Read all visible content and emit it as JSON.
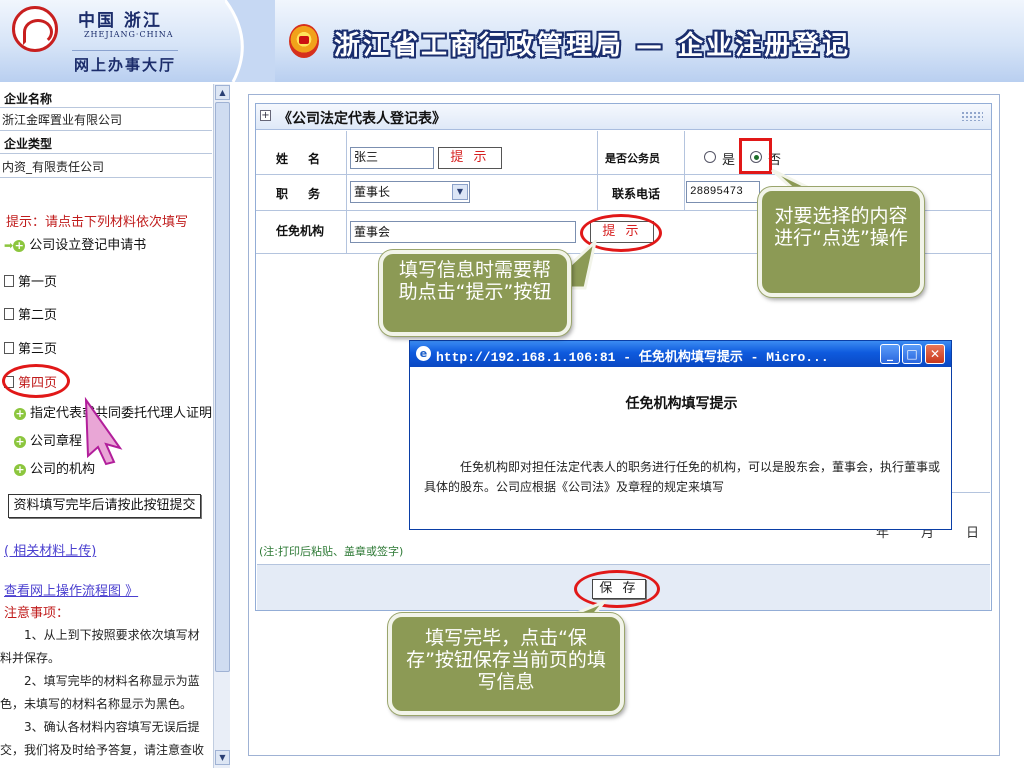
{
  "header": {
    "logo_cn": "中国 浙江",
    "logo_en": "ZHEJIANG·CHINA",
    "logo_sub": "网上办事大厅",
    "title": "浙江省工商行政管理局 — 企业注册登记"
  },
  "sidebar": {
    "company_name_label": "企业名称",
    "company_name_value": "浙江金晖置业有限公司",
    "company_type_label": "企业类型",
    "company_type_value": "内资_有限责任公司",
    "tip": "提示：请点击下列材料依次填写",
    "items": [
      {
        "label": "公司设立登记申请书"
      },
      {
        "label": "第一页"
      },
      {
        "label": "第二页"
      },
      {
        "label": "第三页"
      },
      {
        "label": "第四页"
      },
      {
        "label": "指定代表或共同委托代理人证明"
      },
      {
        "label": "公司章程"
      },
      {
        "label": "公司的机构"
      }
    ],
    "submit_button": "资料填写完毕后请按此按钮提交",
    "upload_link": "( 相关材料上传)",
    "flow_link": "查看网上操作流程图 》",
    "notes_title": "注意事项：",
    "notes": [
      "　　1、从上到下按照要求依次填写材料并保存。",
      "　　2、填写完毕的材料名称显示为蓝色，未填写的材料名称显示为黑色。",
      "　　3、确认各材料内容填写无误后提交，我们将及时给予答复，请注意查收"
    ]
  },
  "form": {
    "title": "《公司法定代表人登记表》",
    "name_label": "姓　名",
    "name_value": "张三",
    "hint_label": "提 示",
    "civil_servant_label": "是否公务员",
    "radio_yes": "是",
    "radio_no": "否",
    "position_label": "职　务",
    "position_value": "董事长",
    "phone_label": "联系电话",
    "phone_value": "28895473",
    "org_label": "任免机构",
    "org_value": "董事会",
    "org_hint": "提 示",
    "date_fragment": "年　　月　　日",
    "note": "(注:打印后粘贴、盖章或签字)",
    "save_button": "保 存"
  },
  "popup": {
    "title": "http://192.168.1.106:81 - 任免机构填写提示 - Micro...",
    "heading": "任免机构填写提示",
    "body": "任免机构即对担任法定代表人的职务进行任免的机构，可以是股东会，董事会，执行董事或具体的股东。公司应根据《公司法》及章程的规定来填写"
  },
  "callouts": {
    "hint": "填写信息时需要帮助点击“提示”按钮",
    "select": "对要选择的内容进行“点选”操作",
    "save": "填写完毕，点击“保存”按钮保存当前页的填写信息"
  },
  "colors": {
    "header_title": "#ffffff",
    "header_outline": "#1a2e6e",
    "tip_red": "#c01c1c",
    "callout_bg": "#8c9a55",
    "ring_red": "#e11818",
    "titlebar_blue": "#0e5ade"
  },
  "icons": [
    "document-icon",
    "plus-icon",
    "arrow-icon",
    "ie-icon",
    "minimize-icon",
    "maximize-icon",
    "close-icon"
  ]
}
